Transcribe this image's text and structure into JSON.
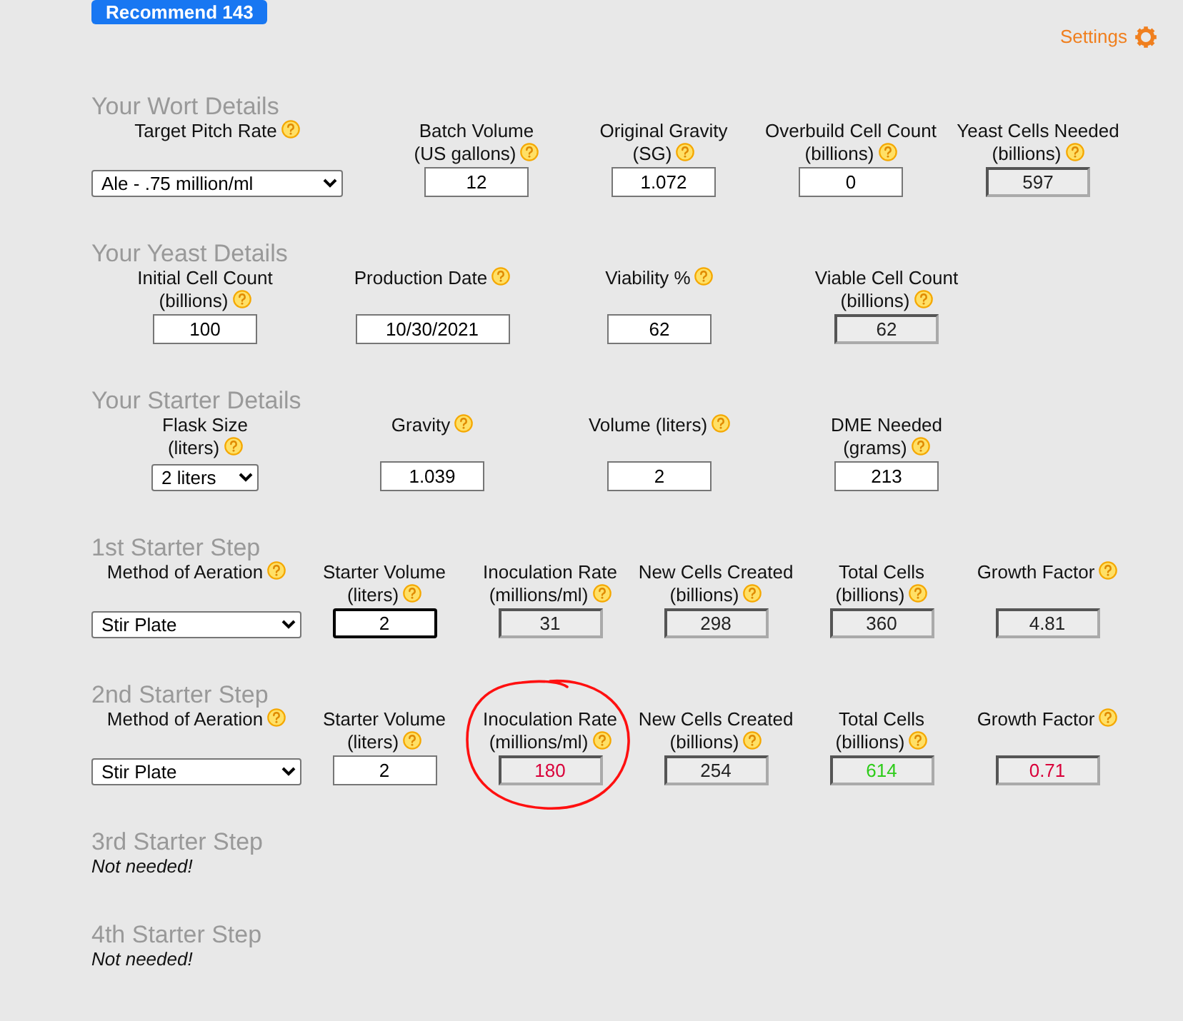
{
  "facebook_button": {
    "label": "Recommend 143"
  },
  "settings_link": {
    "label": "Settings"
  },
  "sections": [
    {
      "kind": "wort",
      "title": "Your Wort Details",
      "fields": [
        {
          "label_lines": [
            "Target Pitch Rate"
          ],
          "kind": "select",
          "value": "Ale - .75 million/ml"
        },
        {
          "label_lines": [
            "Batch Volume",
            "(US gallons)"
          ],
          "kind": "input",
          "value": "12",
          "focused": false
        },
        {
          "label_lines": [
            "Original Gravity",
            "(SG)"
          ],
          "kind": "input",
          "value": "1.072",
          "focused": false
        },
        {
          "label_lines": [
            "Overbuild Cell Count",
            "(billions)"
          ],
          "kind": "input",
          "value": "0",
          "focused": false
        },
        {
          "label_lines": [
            "Yeast Cells Needed",
            "(billions)"
          ],
          "kind": "output",
          "value": "597",
          "color": "#222222"
        }
      ]
    },
    {
      "kind": "details",
      "title": "Your Yeast Details",
      "fields": [
        {
          "label_lines": [
            "Initial Cell Count",
            "(billions)"
          ],
          "kind": "input",
          "value": "100",
          "focused": false
        },
        {
          "label_lines": [
            "Production Date"
          ],
          "kind": "input",
          "value": "10/30/2021",
          "focused": false
        },
        {
          "label_lines": [
            "Viability %"
          ],
          "kind": "input",
          "value": "62",
          "focused": false
        },
        {
          "label_lines": [
            "Viable Cell Count",
            "(billions)"
          ],
          "kind": "output",
          "value": "62",
          "color": "#222222"
        }
      ]
    },
    {
      "kind": "details",
      "title": "Your Starter Details",
      "fields": [
        {
          "label_lines": [
            "Flask Size",
            "(liters)"
          ],
          "kind": "select",
          "value": "2 liters"
        },
        {
          "label_lines": [
            "Gravity"
          ],
          "kind": "input",
          "value": "1.039",
          "focused": false
        },
        {
          "label_lines": [
            "Volume (liters)"
          ],
          "kind": "input",
          "value": "2",
          "focused": false
        },
        {
          "label_lines": [
            "DME Needed",
            "(grams)"
          ],
          "kind": "input",
          "value": "213",
          "focused": false
        }
      ]
    },
    {
      "kind": "step",
      "title": "1st Starter Step",
      "fields": [
        {
          "label_lines": [
            "Method of Aeration"
          ],
          "kind": "select",
          "value": "Stir Plate"
        },
        {
          "label_lines": [
            "Starter Volume",
            "(liters)"
          ],
          "kind": "input",
          "value": "2",
          "focused": true
        },
        {
          "label_lines": [
            "Inoculation Rate",
            "(millions/ml)"
          ],
          "kind": "output",
          "value": "31",
          "color": "#222222"
        },
        {
          "label_lines": [
            "New Cells Created",
            "(billions)"
          ],
          "kind": "output",
          "value": "298",
          "color": "#222222"
        },
        {
          "label_lines": [
            "Total Cells",
            "(billions)"
          ],
          "kind": "output",
          "value": "360",
          "color": "#222222"
        },
        {
          "label_lines": [
            "Growth Factor"
          ],
          "kind": "output",
          "value": "4.81",
          "color": "#222222"
        }
      ]
    },
    {
      "kind": "step",
      "title": "2nd Starter Step",
      "fields": [
        {
          "label_lines": [
            "Method of Aeration"
          ],
          "kind": "select",
          "value": "Stir Plate"
        },
        {
          "label_lines": [
            "Starter Volume",
            "(liters)"
          ],
          "kind": "input",
          "value": "2",
          "focused": false
        },
        {
          "label_lines": [
            "Inoculation Rate",
            "(millions/ml)"
          ],
          "kind": "output",
          "value": "180",
          "color": "#d9003a",
          "circled": true
        },
        {
          "label_lines": [
            "New Cells Created",
            "(billions)"
          ],
          "kind": "output",
          "value": "254",
          "color": "#222222"
        },
        {
          "label_lines": [
            "Total Cells",
            "(billions)"
          ],
          "kind": "output",
          "value": "614",
          "color": "#2ecc1a"
        },
        {
          "label_lines": [
            "Growth Factor"
          ],
          "kind": "output",
          "value": "0.71",
          "color": "#d9003a"
        }
      ]
    },
    {
      "kind": "skipped",
      "title": "3rd Starter Step",
      "note": "Not needed!"
    },
    {
      "kind": "skipped",
      "title": "4th Starter Step",
      "note": "Not needed!"
    }
  ]
}
